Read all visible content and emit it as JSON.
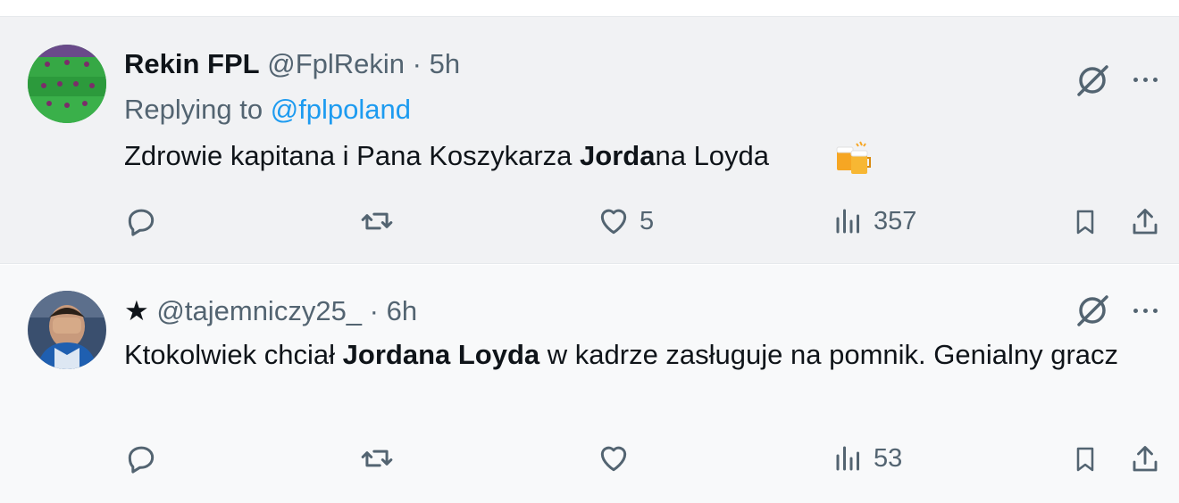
{
  "tweets": [
    {
      "author_name": "Rekin FPL",
      "handle": "@FplRekin",
      "separator": "·",
      "time": "5h",
      "replying_prefix": "Replying to",
      "replying_to": "@fplpoland",
      "text_plain_1": "Zdrowie kapitana i Pana Koszykarza ",
      "text_bold_1": "Jorda",
      "text_plain_2": "na Loyda",
      "emoji": "🍻",
      "actions": {
        "reply": "",
        "repost": "",
        "like": "5",
        "views": "357"
      }
    },
    {
      "author_name": "★",
      "handle": "@tajemniczy25_",
      "separator": "·",
      "time": "6h",
      "text_plain_1": "Ktokolwiek chciał ",
      "text_bold_1": "Jordana Loyda",
      "text_plain_2": " w kadrze zasługuje na pomnik.  Genialny gracz",
      "actions": {
        "reply": "",
        "repost": "",
        "like": "",
        "views": "53"
      }
    }
  ],
  "icons": {
    "grok": "grok-icon",
    "more": "more-icon",
    "reply": "reply-icon",
    "repost": "repost-icon",
    "like": "like-icon",
    "views": "views-icon",
    "bookmark": "bookmark-icon",
    "share": "share-icon"
  },
  "colors": {
    "link": "#1d9bf0",
    "muted": "#536471",
    "text": "#0f1419"
  }
}
